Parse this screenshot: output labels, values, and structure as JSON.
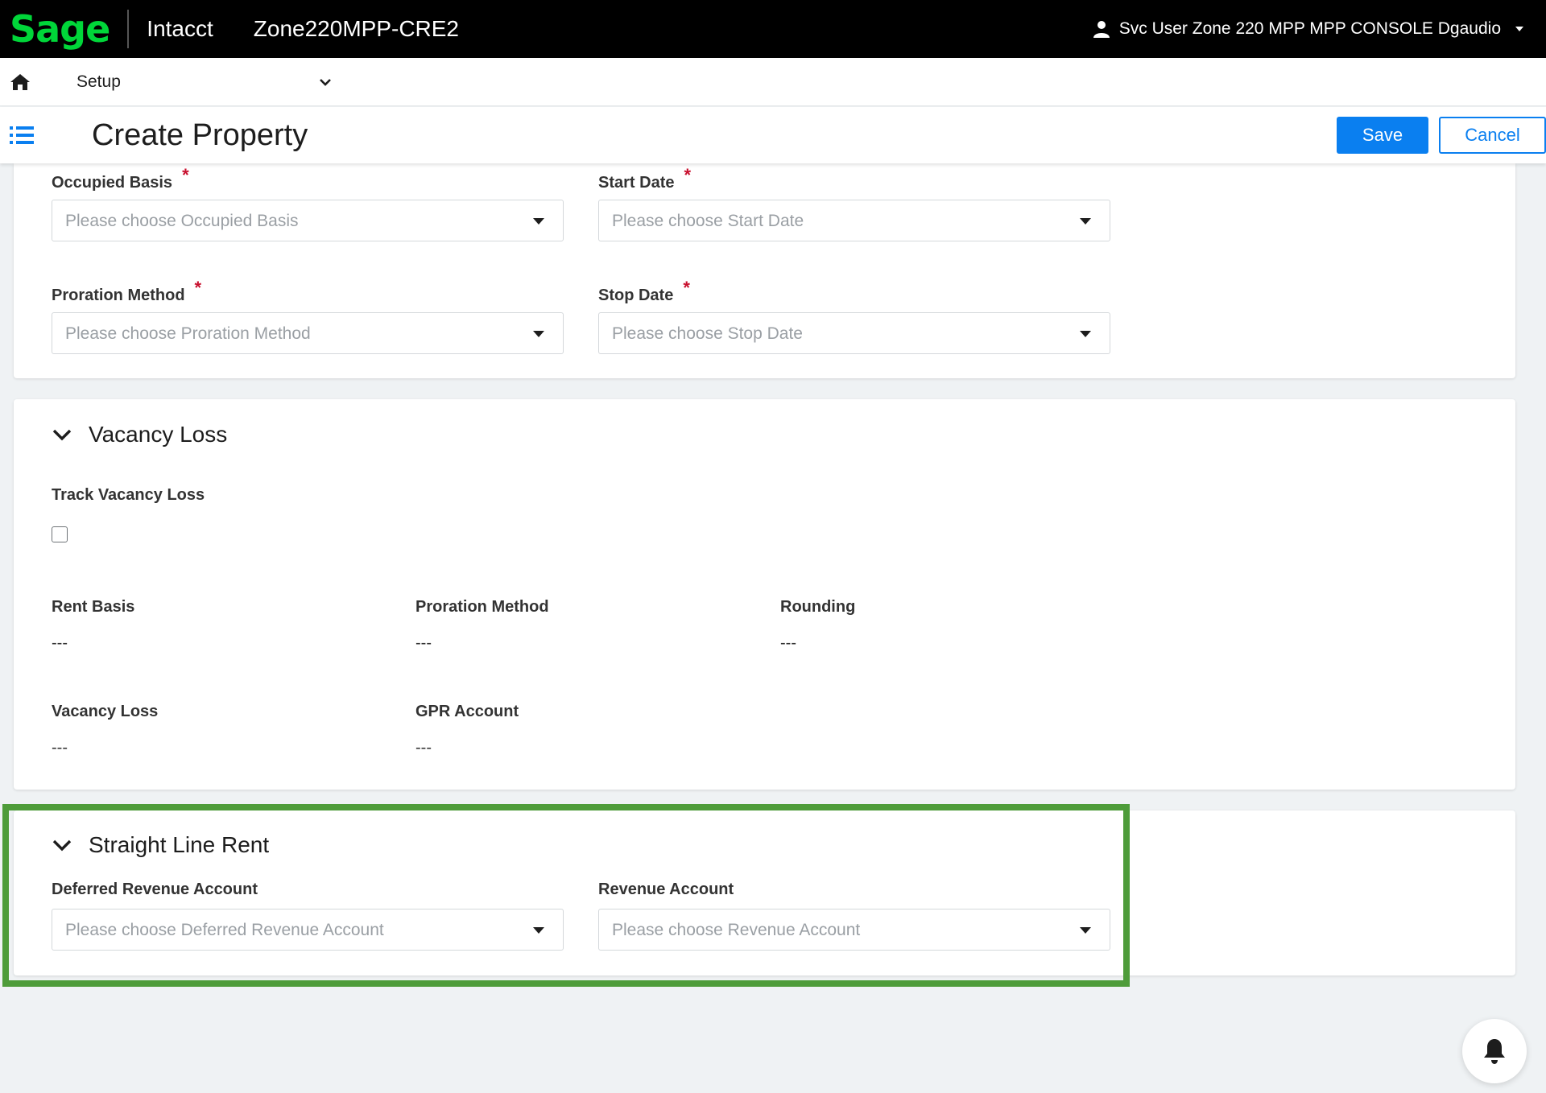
{
  "topbar": {
    "logo_text": "Sage",
    "product": "Intacct",
    "company": "Zone220MPP-CRE2",
    "user_name": "Svc User Zone 220 MPP MPP CONSOLE Dgaudio"
  },
  "nav": {
    "module": "Setup"
  },
  "page": {
    "title": "Create Property",
    "save_label": "Save",
    "cancel_label": "Cancel"
  },
  "top_section": {
    "occupied_basis": {
      "label": "Occupied Basis",
      "placeholder": "Please choose Occupied Basis",
      "required": "*"
    },
    "start_date": {
      "label": "Start Date",
      "placeholder": "Please choose Start Date",
      "required": "*"
    },
    "proration_method": {
      "label": "Proration Method",
      "placeholder": "Please choose Proration Method",
      "required": "*"
    },
    "stop_date": {
      "label": "Stop Date",
      "placeholder": "Please choose Stop Date",
      "required": "*"
    }
  },
  "vacancy_loss": {
    "title": "Vacancy Loss",
    "track_label": "Track Vacancy Loss",
    "track_checked": false,
    "fields": {
      "rent_basis": {
        "label": "Rent Basis",
        "value": "---"
      },
      "proration_method": {
        "label": "Proration Method",
        "value": "---"
      },
      "rounding": {
        "label": "Rounding",
        "value": "---"
      },
      "vacancy_loss": {
        "label": "Vacancy Loss",
        "value": "---"
      },
      "gpr_account": {
        "label": "GPR Account",
        "value": "---"
      }
    }
  },
  "straight_line_rent": {
    "title": "Straight Line Rent",
    "deferred_revenue": {
      "label": "Deferred Revenue Account",
      "placeholder": "Please choose Deferred Revenue Account"
    },
    "revenue": {
      "label": "Revenue Account",
      "placeholder": "Please choose Revenue Account"
    }
  },
  "colors": {
    "brand_green": "#00d639",
    "primary_blue": "#0a7ff0",
    "required_red": "#c8102e",
    "highlight_green": "#4e9c3a"
  },
  "icons": {
    "home": "home-icon",
    "list": "list-icon",
    "user": "user-icon",
    "bell": "bell-icon"
  }
}
